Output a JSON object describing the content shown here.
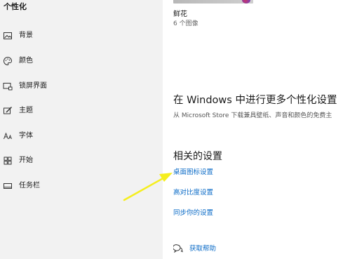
{
  "sidebar": {
    "title": "个性化",
    "items": [
      {
        "label": "背景"
      },
      {
        "label": "颜色"
      },
      {
        "label": "锁屏界面"
      },
      {
        "label": "主题"
      },
      {
        "label": "字体"
      },
      {
        "label": "开始"
      },
      {
        "label": "任务栏"
      }
    ]
  },
  "theme": {
    "name": "鲜花",
    "count": "6 个图像"
  },
  "more": {
    "title": "在 Windows 中进行更多个性化设置",
    "description": "从 Microsoft Store 下载兼具壁纸、声音和颜色的免费主"
  },
  "related": {
    "title": "相关的设置",
    "links": [
      "桌面图标设置",
      "高对比度设置",
      "同步你的设置"
    ]
  },
  "help": {
    "label": "获取帮助"
  },
  "colors": {
    "accent": "#0b6bc7",
    "sidebar_bg": "#f2f2f2",
    "annotation_arrow": "#f5ee1e"
  }
}
